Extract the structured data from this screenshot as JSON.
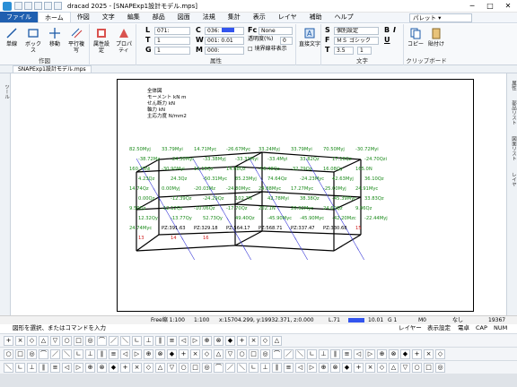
{
  "window": {
    "title": "dracad 2025 - [SNAPExp1設計モデル.mps]"
  },
  "tabs": [
    "ファイル",
    "ホーム",
    "作図",
    "文字",
    "編集",
    "部品",
    "図面",
    "法規",
    "集計",
    "表示",
    "レイヤ",
    "補助",
    "ヘルプ"
  ],
  "palette_label": "パレット",
  "ribbon": {
    "buttons": [
      {
        "label": "単線"
      },
      {
        "label": "ボックス"
      },
      {
        "label": "移動"
      },
      {
        "label": "平行複写"
      }
    ],
    "attr_buttons": [
      {
        "label": "属性設定"
      },
      {
        "label": "プロパティ"
      }
    ],
    "sakuzu_group": "作図",
    "zokusei_group": "属性",
    "L_value": "071:",
    "T_value": "1",
    "G_value": "1",
    "C_value": "036:",
    "W_value": "001: 0.01",
    "M_value": "000:",
    "Fc_value": "None",
    "transparency_label": "透明度(%)",
    "transparency_value": "0",
    "boundary_label": "□ 境界線非表示",
    "direct_label": "直接文字",
    "moji_group": "文字",
    "S_value": "個別設定",
    "F_value": "ＭＳ ゴシック",
    "size_value": "3.5",
    "ratio_value": "1",
    "clip_group": "クリップボード",
    "copy_label": "コピー",
    "paste_label": "貼付け"
  },
  "doc_tab": "SNAPExp1設計モデル.mps",
  "left_panel": [
    "ツール"
  ],
  "right_panel": [
    "属性",
    "部品リスト",
    "図面リスト",
    "レイヤ"
  ],
  "legend": [
    "全体図",
    "モーメント kN m",
    "せん断力 kN",
    "軸力 kN",
    "主応力度 N/mm2"
  ],
  "labels": [
    {
      "t": "82.50Myj",
      "c": "g"
    },
    {
      "t": "33.79Myi",
      "c": "g"
    },
    {
      "t": "14.71Myc",
      "c": "g"
    },
    {
      "t": "-26.67Myc",
      "c": "g"
    },
    {
      "t": "33.24Myj",
      "c": "g"
    },
    {
      "t": "33.79Myi",
      "c": "g"
    },
    {
      "t": "70.50Myj",
      "c": "g"
    },
    {
      "t": "-30.72Myi",
      "c": "g"
    },
    {
      "t": "-38.72Mz",
      "c": "g"
    },
    {
      "t": "-24.30Myi",
      "c": "g"
    },
    {
      "t": "-33.38Myj",
      "c": "g"
    },
    {
      "t": "-33.33Myi",
      "c": "g"
    },
    {
      "t": "-33.4Myi",
      "c": "g"
    },
    {
      "t": "33.82Qz",
      "c": "g"
    },
    {
      "t": "17.16Qz",
      "c": "g"
    },
    {
      "t": "-24.70Qzi",
      "c": "g"
    },
    {
      "t": "160.75Ni",
      "c": "g"
    },
    {
      "t": "-30.90Myi",
      "c": "g"
    },
    {
      "t": "16.18Qz",
      "c": "g"
    },
    {
      "t": "14.68Qz",
      "c": "g"
    },
    {
      "t": "-16.48Qz",
      "c": "g"
    },
    {
      "t": "-32.79Qz",
      "c": "g"
    },
    {
      "t": "16.08Qy",
      "c": "g"
    },
    {
      "t": "165.0N",
      "c": "g"
    },
    {
      "t": "4.23Qz",
      "c": "g"
    },
    {
      "t": "24.3Qz",
      "c": "g"
    },
    {
      "t": "-50.31Myc",
      "c": "g"
    },
    {
      "t": "85.23Myj",
      "c": "g"
    },
    {
      "t": "74.64Qz",
      "c": "g"
    },
    {
      "t": "-24.23Myc",
      "c": "g"
    },
    {
      "t": "42.63Myj",
      "c": "g"
    },
    {
      "t": "36.10Qz",
      "c": "g"
    },
    {
      "t": "14.74Qz",
      "c": "g"
    },
    {
      "t": "0.00Myj",
      "c": "g"
    },
    {
      "t": "-20.03Mz",
      "c": "g"
    },
    {
      "t": "-24.80Myc",
      "c": "g"
    },
    {
      "t": "24.88Myc",
      "c": "g"
    },
    {
      "t": "17.27Myc",
      "c": "g"
    },
    {
      "t": "-25.00Myj",
      "c": "g"
    },
    {
      "t": "24.91Myc",
      "c": "g"
    },
    {
      "t": "0.00Qz",
      "c": "g"
    },
    {
      "t": "-12.39Qz",
      "c": "g"
    },
    {
      "t": "-24.29Qz",
      "c": "g"
    },
    {
      "t": "102.7N",
      "c": "g"
    },
    {
      "t": "42.78Myi",
      "c": "g"
    },
    {
      "t": "38.38Qz",
      "c": "g"
    },
    {
      "t": "-45.39Myc",
      "c": "g"
    },
    {
      "t": "33.83Qz",
      "c": "g"
    },
    {
      "t": "9.50Qz",
      "c": "g"
    },
    {
      "t": "-12.12Qz",
      "c": "g"
    },
    {
      "t": "-10.06Qz",
      "c": "g"
    },
    {
      "t": "-17.70Qz",
      "c": "g"
    },
    {
      "t": "202.1N",
      "c": "g"
    },
    {
      "t": "20.92Myc",
      "c": "g"
    },
    {
      "t": "24.60Qz",
      "c": "g"
    },
    {
      "t": "9.96Qz",
      "c": "g"
    },
    {
      "t": "12.32Qy",
      "c": "g"
    },
    {
      "t": "-13.77Qy",
      "c": "g"
    },
    {
      "t": "52.73Qy",
      "c": "g"
    },
    {
      "t": "49.40Qz",
      "c": "g"
    },
    {
      "t": "-45.90Myc",
      "c": "g"
    },
    {
      "t": "-45.90Myc",
      "c": "g"
    },
    {
      "t": "-42.20Mzc",
      "c": "g"
    },
    {
      "t": "-22.44Myj",
      "c": "g"
    },
    {
      "t": "24.74Myc",
      "c": "g"
    },
    {
      "t": "PZ:391.63",
      "c": "k"
    },
    {
      "t": "PZ:329.18",
      "c": "k"
    },
    {
      "t": "PZ:564.17",
      "c": "k"
    },
    {
      "t": "PZ:568.71",
      "c": "k"
    },
    {
      "t": "PZ:337.47",
      "c": "k"
    },
    {
      "t": "PZ:330.68",
      "c": "k"
    },
    {
      "t": "15",
      "c": "r"
    },
    {
      "t": "13",
      "c": "r"
    },
    {
      "t": "14",
      "c": "r"
    },
    {
      "t": "16",
      "c": "r"
    }
  ],
  "status": {
    "scale": "Free縮 1:100",
    "scale2": "1:100",
    "coords": "x:15704.299, y:19932.371, z:0.000",
    "line": "L.71",
    "w": "10.01",
    "g": "G 1",
    "m": "M0",
    "none": "なし",
    "count": "19367"
  },
  "message": "図形を選択、またはコマンドを入力",
  "msg_right": [
    "レイヤー",
    "表示設定",
    "電卓",
    "CAP",
    "NUM"
  ]
}
